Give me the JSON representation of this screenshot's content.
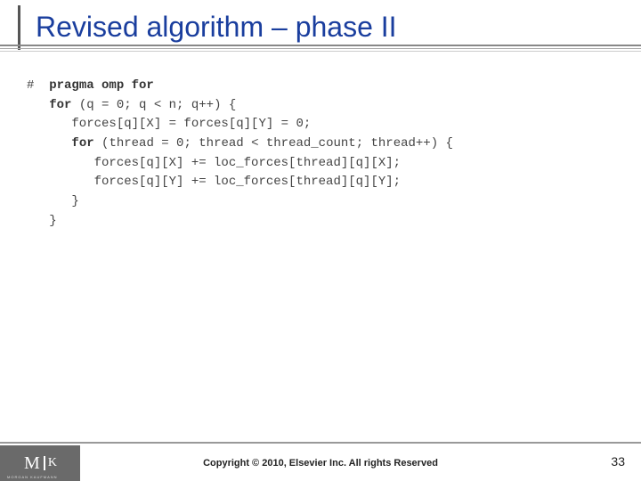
{
  "slide": {
    "title": "Revised algorithm – phase II",
    "code": {
      "directive_hash": "#",
      "directive_keywords": "pragma omp for",
      "for1_kw": "for",
      "for1_rest": " (q = 0; q < n; q++) {",
      "line_init": "      forces[q][X] = forces[q][Y] = 0;",
      "for2_kw": "for",
      "for2_rest": " (thread = 0; thread < thread_count; thread++) {",
      "line_accx": "         forces[q][X] += loc_forces[thread][q][X];",
      "line_accy": "         forces[q][Y] += loc_forces[thread][q][Y];",
      "brace_inner": "      }",
      "brace_outer": "   }"
    },
    "footer": {
      "copyright": "Copyright © 2010, Elsevier Inc. All rights Reserved",
      "page_number": "33",
      "logo_main": "M",
      "logo_sub": "K",
      "logo_caption": "MORGAN KAUFMANN"
    }
  }
}
